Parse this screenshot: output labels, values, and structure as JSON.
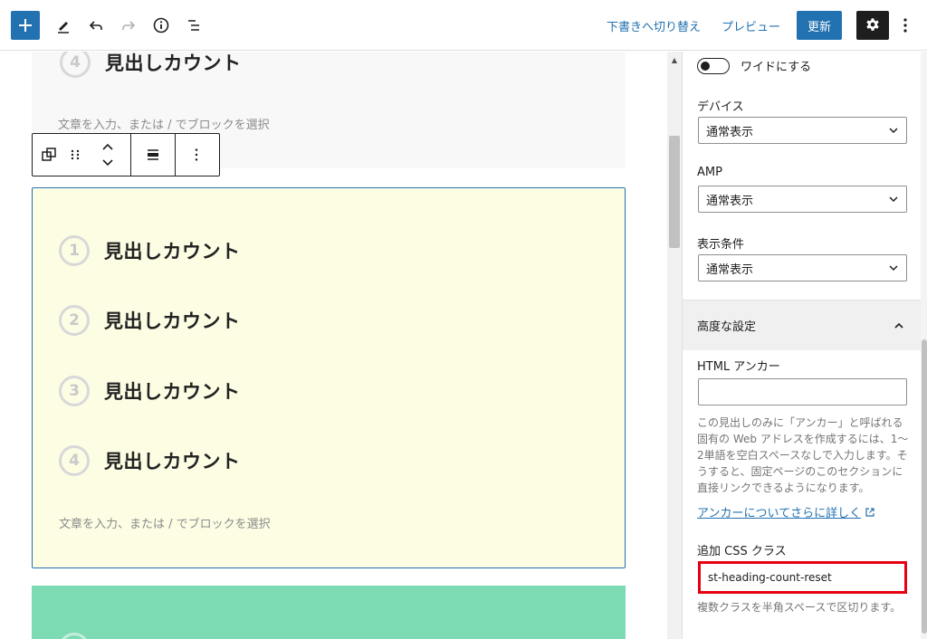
{
  "header": {
    "draft_label": "下書きへ切り替え",
    "preview_label": "プレビュー",
    "update_label": "更新"
  },
  "canvas": {
    "top_heading_number": "4",
    "top_heading": "見出しカウント",
    "placeholder": "文章を入力、または / でブロックを選択",
    "headings": [
      {
        "number": "1",
        "text": "見出しカウント"
      },
      {
        "number": "2",
        "text": "見出しカウント"
      },
      {
        "number": "3",
        "text": "見出しカウント"
      },
      {
        "number": "4",
        "text": "見出しカウント"
      }
    ],
    "colors": {
      "selected_bg": "#fdfde4",
      "green_bg": "#7ddbb3",
      "top_bg": "#f8f8f8"
    }
  },
  "sidebar": {
    "wide_toggle_label": "ワイドにする",
    "device_label": "デバイス",
    "device_value": "通常表示",
    "amp_label": "AMP",
    "amp_value": "通常表示",
    "condition_label": "表示条件",
    "condition_value": "通常表示",
    "advanced_title": "高度な設定",
    "anchor_label": "HTML アンカー",
    "anchor_value": "",
    "anchor_help": "この見出しのみに「アンカー」と呼ばれる固有の Web アドレスを作成するには、1〜2単語を空白スペースなしで入力します。そうすると、固定ページのこのセクションに直接リンクできるようになります。",
    "anchor_link": "アンカーについてさらに詳しく",
    "css_label": "追加 CSS クラス",
    "css_value": "st-heading-count-reset",
    "css_help": "複数クラスを半角スペースで区切ります。"
  },
  "accent_color": "#2271b1",
  "highlight_color": "#e60012"
}
